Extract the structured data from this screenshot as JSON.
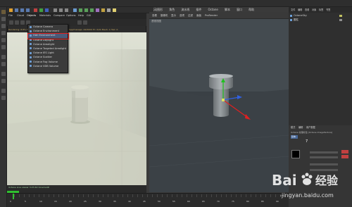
{
  "menubar": {
    "items": [
      "文件",
      "编辑",
      "创建",
      "选择",
      "工具",
      "网格",
      "捕捉",
      "动画",
      "模拟",
      "渲染",
      "雕刻",
      "运动跟踪",
      "运动图形",
      "角色",
      "流水线",
      "插件",
      "Octane",
      "脚本",
      "窗口",
      "帮助"
    ]
  },
  "octane": {
    "tabs": [
      "File",
      "Cloud",
      "Objects",
      "Materials",
      "Compare",
      "Options",
      "Help",
      "GUI"
    ],
    "status_text": "Octane Live viewer",
    "render_info": "Rendering: 8.8% Ms/sec: 0.000 Time: 00:00:01/00:00:10 Spp/maxspp: 44/5000 Tri: 0/2k Mesh: 1 Hair: 0",
    "bottom_info": "Octane Live viewer 3.07-R2 Cinema4D"
  },
  "dropdown": {
    "items": [
      {
        "label": "Octane Camera",
        "highlighted": false
      },
      {
        "label": "Octane Environment",
        "highlighted": false
      },
      {
        "label": "Hdri Environment",
        "highlighted": true
      },
      {
        "label": "Octane Daylight",
        "highlighted": false
      },
      {
        "label": "Octane Arealight",
        "highlighted": false
      },
      {
        "label": "Octane Targeted Arealight",
        "highlighted": false
      },
      {
        "label": "Octane IES Light",
        "highlighted": false
      },
      {
        "label": "Octane Scatter",
        "highlighted": false
      },
      {
        "label": "Octane Fog Volume",
        "highlighted": false
      },
      {
        "label": "Octane VDB Volume",
        "highlighted": false
      }
    ],
    "highlight_color": "#e02020"
  },
  "viewport": {
    "menus": [
      "查看",
      "摄像机",
      "显示",
      "选项",
      "过滤",
      "面板",
      "ProRender"
    ],
    "label": "透视视图"
  },
  "right_panel": {
    "tabs": [
      "文件",
      "编辑",
      "查看",
      "对象",
      "标签",
      "书签"
    ],
    "objects": [
      "OctaneSky",
      "圆柱"
    ],
    "attr_tabs": [
      "模式",
      "编辑",
      "用户数据"
    ],
    "attr_title": "Octane 纹理标签 [Octane ImageTexture]",
    "attr_section": "基本",
    "value": "7"
  },
  "timeline": {
    "frames": [
      "0",
      "5",
      "10",
      "15",
      "20",
      "25",
      "30",
      "35",
      "40",
      "45",
      "50",
      "55",
      "60",
      "65",
      "70",
      "75",
      "80",
      "85",
      "90"
    ],
    "current": "0 F"
  },
  "watermark": {
    "brand": "Bai",
    "brand2": "经验",
    "url": "jingyan.baidu.com"
  },
  "colors": {
    "render_bg": "#dfe2d5",
    "viewport_bg": "#444b50",
    "axis_x": "#e02020",
    "axis_y": "#20c020",
    "axis_z": "#3060e0"
  }
}
